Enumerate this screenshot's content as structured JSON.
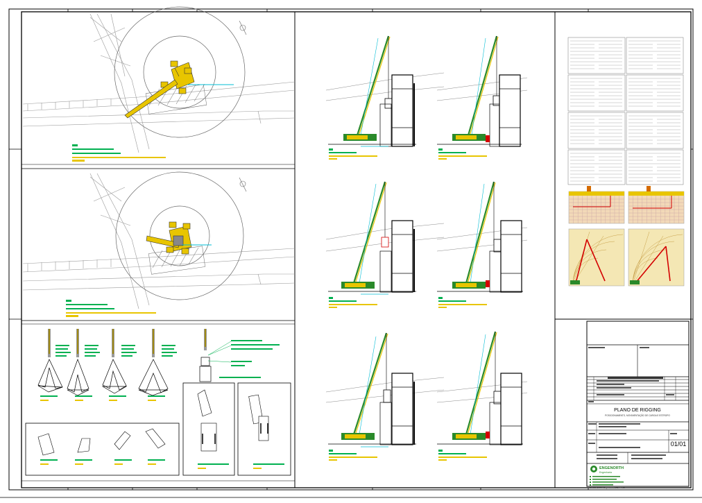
{
  "title_block": {
    "plan_title": "PLANO DE RIGGING",
    "plan_subtitle": "POSICIONAMENTO, MOVIMENTAÇÃO DE CARGA E ESTROPO",
    "sheet_number": "01/01",
    "company_name": "ENGENORTH",
    "company_tagline": "Engenharia",
    "company_footer": "ENGENORTH Engenharia LTDA - ME"
  },
  "colors": {
    "line": "#9a9a9a",
    "dark_line": "#000000",
    "crane_yellow": "#e8c500",
    "crane_green": "#2a8a2a",
    "annotation_green": "#00b050",
    "cyan": "#00bcd4",
    "red": "#d40000",
    "chart_bg": "#f4e7b4"
  }
}
